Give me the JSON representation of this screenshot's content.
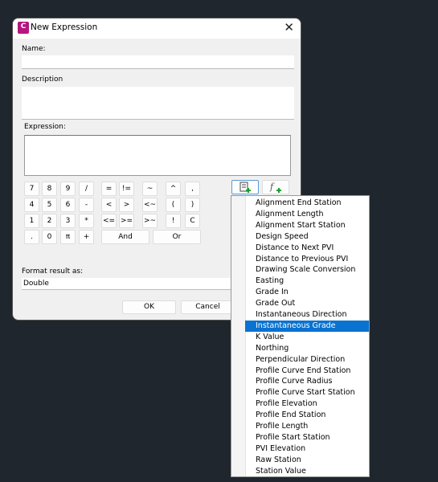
{
  "dialog": {
    "title": "New Expression",
    "app_icon_letter": "C",
    "close_label": "✕"
  },
  "name": {
    "label": "Name:",
    "value": ""
  },
  "description": {
    "label": "Description",
    "value": ""
  },
  "expression": {
    "label": "Expression:",
    "value": ""
  },
  "keypad": [
    [
      "7",
      "8",
      "9",
      "/",
      "=",
      "!=",
      "~",
      "^",
      ","
    ],
    [
      "4",
      "5",
      "6",
      "-",
      "<",
      ">",
      "<~",
      "(",
      ")"
    ],
    [
      "1",
      "2",
      "3",
      "*",
      "<=",
      ">=",
      ">~",
      "!",
      "C"
    ],
    [
      ".",
      "0",
      "π",
      "+",
      "And",
      "Or"
    ]
  ],
  "tool_buttons": [
    {
      "name": "insert-property-icon",
      "selected": true
    },
    {
      "name": "insert-function-icon",
      "selected": false
    }
  ],
  "format": {
    "label": "Format result as:",
    "value": "Double"
  },
  "buttons": {
    "ok": "OK",
    "cancel": "Cancel"
  },
  "dropdown": {
    "selected": "Instantaneous Grade",
    "highlight_color": "#0a72d0",
    "items": [
      "Alignment End Station",
      "Alignment Length",
      "Alignment Start Station",
      "Design Speed",
      "Distance to Next PVI",
      "Distance to Previous PVI",
      "Drawing Scale Conversion",
      "Easting",
      "Grade In",
      "Grade Out",
      "Instantaneous Direction",
      "Instantaneous Grade",
      "K Value",
      "Northing",
      "Perpendicular Direction",
      "Profile Curve End Station",
      "Profile Curve Radius",
      "Profile Curve Start Station",
      "Profile Elevation",
      "Profile End Station",
      "Profile Length",
      "Profile Start Station",
      "PVI Elevation",
      "Raw Station",
      "Station Value"
    ]
  }
}
